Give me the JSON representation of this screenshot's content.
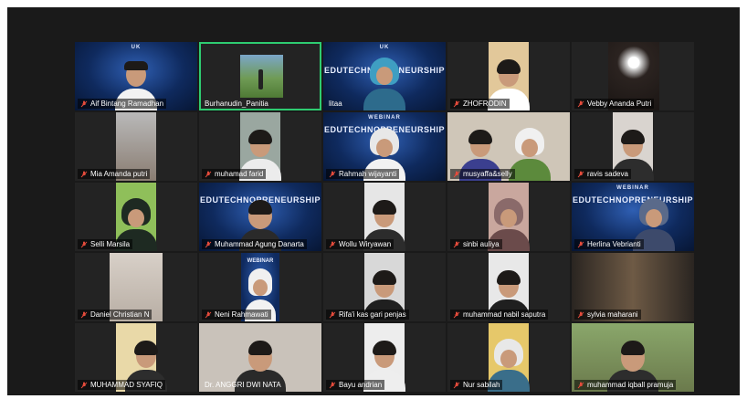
{
  "window": {
    "background": "#1a1a1a",
    "active_outline": "#2ecc71",
    "mute_color": "#e74c3c"
  },
  "participants": [
    {
      "name": "Aif Bintang Ramadhan",
      "muted": true
    },
    {
      "name": "Burhanudin_Panitia",
      "muted": false
    },
    {
      "name": "litaa",
      "muted": false
    },
    {
      "name": "ZHOFRODIN",
      "muted": true
    },
    {
      "name": "Vebby Ananda Putri",
      "muted": true
    },
    {
      "name": "Mia Amanda putri",
      "muted": true
    },
    {
      "name": "muhamad farid",
      "muted": true
    },
    {
      "name": "Rahmah wijayanti",
      "muted": true
    },
    {
      "name": "musyaffa&selly",
      "muted": true
    },
    {
      "name": "ravis sadeva",
      "muted": true
    },
    {
      "name": "Selli Marsila",
      "muted": true
    },
    {
      "name": "Muhammad Agung Danarta",
      "muted": true
    },
    {
      "name": "Wollu Wiryawan",
      "muted": true
    },
    {
      "name": "sinbi auliya",
      "muted": true
    },
    {
      "name": "Herlina Vebrianti",
      "muted": true
    },
    {
      "name": "Daniel Christian N",
      "muted": true
    },
    {
      "name": "Neni Rahmawati",
      "muted": true
    },
    {
      "name": "Rifa'i kas gari penjas",
      "muted": true
    },
    {
      "name": "muhammad nabil saputra",
      "muted": true
    },
    {
      "name": "sylvia maharani",
      "muted": true
    },
    {
      "name": "MUHAMMAD SYAFIQ",
      "muted": true
    },
    {
      "name": "Dr. ANGGRI DWI NATA",
      "muted": true
    },
    {
      "name": "Bayu andrian",
      "muted": true
    },
    {
      "name": "Nur sabilah",
      "muted": true
    },
    {
      "name": "muhammad iqball pramuja",
      "muted": true
    }
  ],
  "banner": {
    "title": "EDUTECHNOPRENEURSHIP",
    "small_title": "WEBINAR",
    "logo": "UK"
  }
}
